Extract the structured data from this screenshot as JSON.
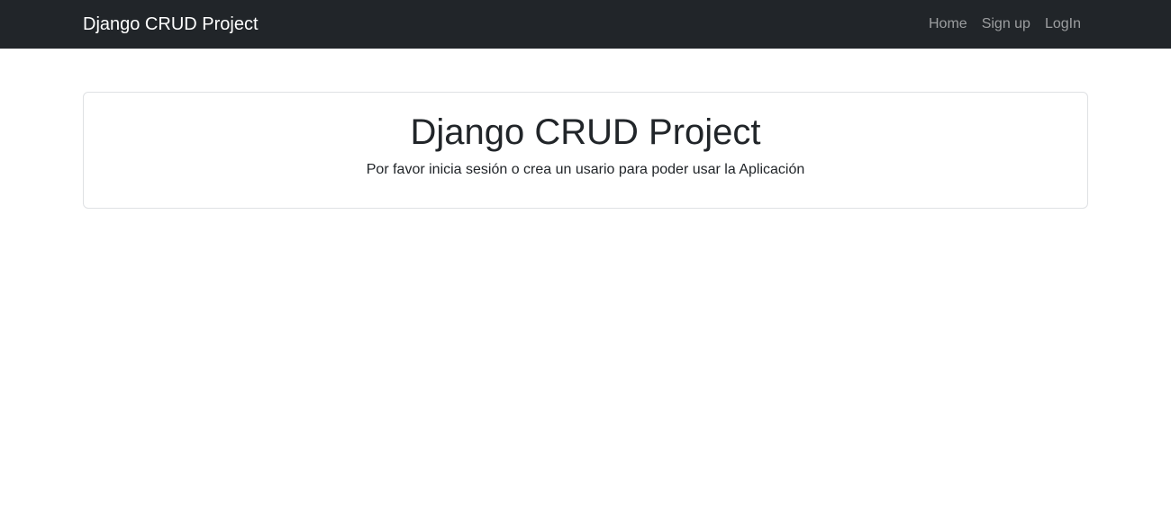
{
  "navbar": {
    "brand": "Django CRUD Project",
    "links": [
      {
        "label": "Home"
      },
      {
        "label": "Sign up"
      },
      {
        "label": "LogIn"
      }
    ]
  },
  "main": {
    "card": {
      "title": "Django CRUD Project",
      "text": "Por favor inicia sesión o crea un usario para poder usar la Aplicación"
    }
  },
  "colors": {
    "navbar_bg": "#212529",
    "brand_text": "#ffffff",
    "nav_link_text": "#8f9296",
    "body_text": "#212529",
    "card_border": "#dfe1e4"
  }
}
